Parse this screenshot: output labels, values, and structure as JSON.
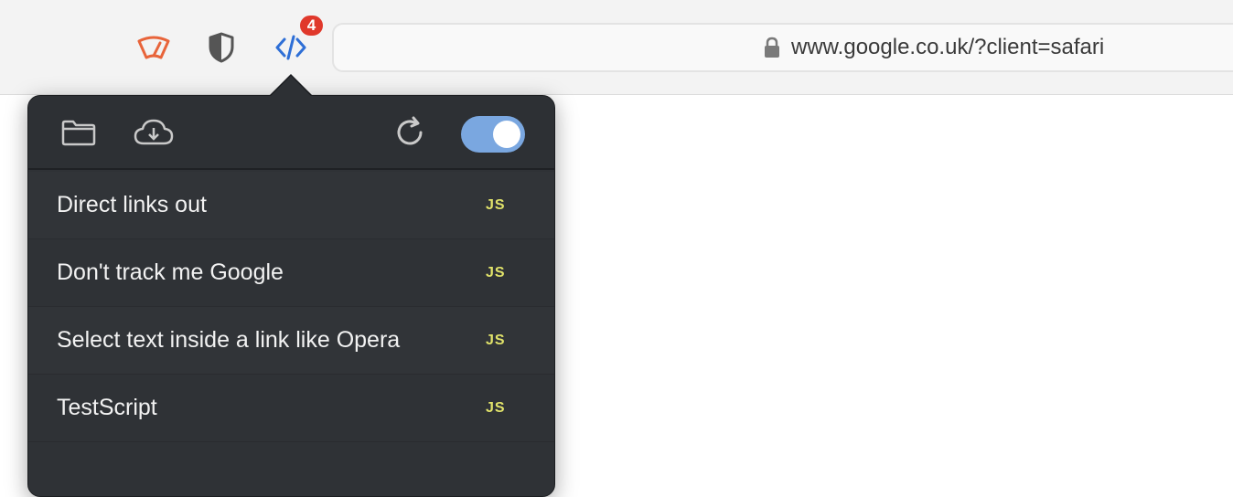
{
  "toolbar": {
    "extensions": [
      {
        "name": "wiper-icon",
        "color": "#e8643a"
      },
      {
        "name": "shield-icon",
        "color": "#555555"
      },
      {
        "name": "code-icon",
        "color": "#2e6fd6"
      }
    ],
    "badge_count": "4"
  },
  "address_bar": {
    "url": "www.google.co.uk/?client=safari",
    "lock_icon": "lock-icon"
  },
  "popover": {
    "header": {
      "folder_icon": "folder-icon",
      "download_icon": "cloud-download-icon",
      "refresh_icon": "refresh-icon",
      "toggle_on": true,
      "toggle_color": "#7aa7e0"
    },
    "scripts": [
      {
        "name": "Direct links out",
        "type": "JS"
      },
      {
        "name": "Don't track me Google",
        "type": "JS"
      },
      {
        "name": "Select text inside a link like Opera",
        "type": "JS"
      },
      {
        "name": "TestScript",
        "type": "JS"
      }
    ]
  }
}
